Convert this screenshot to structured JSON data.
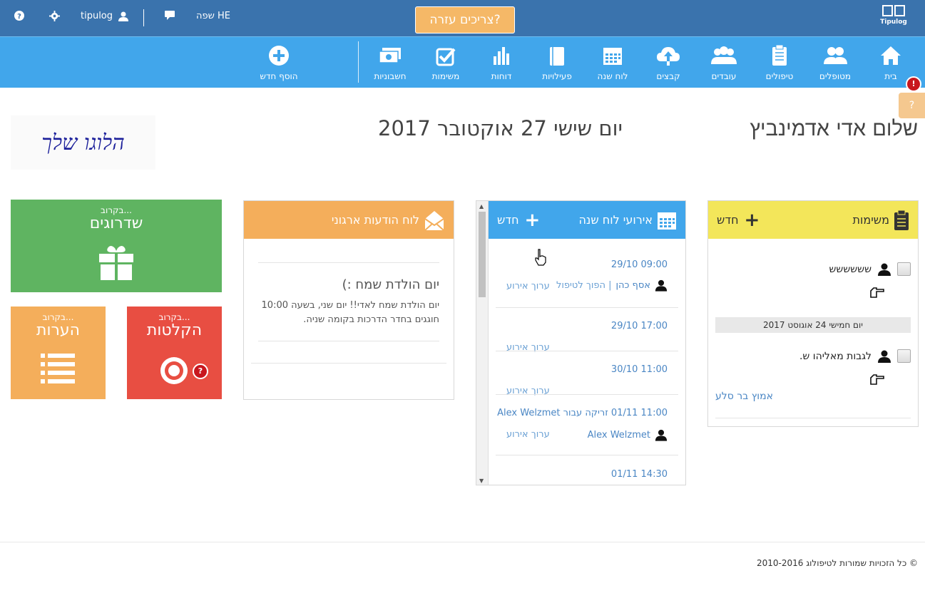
{
  "topbar": {
    "help_button": "צריכים עזרה?",
    "language": "שפה HE",
    "username": "tipulog",
    "brand": "Tipulog"
  },
  "nav": [
    {
      "label": "בית",
      "icon": "home-icon"
    },
    {
      "label": "מטופלים",
      "icon": "patients-icon"
    },
    {
      "label": "טיפולים",
      "icon": "clipboard-icon"
    },
    {
      "label": "עובדים",
      "icon": "workers-icon"
    },
    {
      "label": "קבצים",
      "icon": "cloud-upload-icon"
    },
    {
      "label": "לוח שנה",
      "icon": "calendar-icon"
    },
    {
      "label": "פעילויות",
      "icon": "book-icon"
    },
    {
      "label": "דוחות",
      "icon": "bar-chart-icon"
    },
    {
      "label": "משימות",
      "icon": "check-icon"
    },
    {
      "label": "חשבוניות",
      "icon": "money-icon"
    },
    {
      "label": "הוסף חדש",
      "icon": "plus-circle-icon"
    }
  ],
  "notification_badge": "!",
  "header": {
    "greeting": "שלום אדי אדמינביץ",
    "date": "יום שישי 27 אוקטובר 2017",
    "logo_placeholder": "הלוגו שלך"
  },
  "tasks": {
    "title": "משימות",
    "new_label": "חדש",
    "items": [
      {
        "text": "שששששש"
      },
      {
        "text": "לגבות מאליהו ש."
      }
    ],
    "date_group": "יום חמישי 24 אוגוסט 2017",
    "assignee": "אמוץ בר סלע"
  },
  "events": {
    "title": "אירועי לוח שנה",
    "new_label": "חדש",
    "edit_label": "ערוך אירוע",
    "items": [
      {
        "when": "09:00 29/10",
        "person": "אסף כהן",
        "extra": "| הפוך לטיפול"
      },
      {
        "when": "17:00 29/10"
      },
      {
        "when": "11:00 30/10"
      },
      {
        "when": "11:00 01/11 זריקה עבור Alex Welzmet",
        "person": "Alex Welzmet"
      },
      {
        "when": "14:30 01/11"
      }
    ]
  },
  "bulletin": {
    "title": "לוח הודעות ארגוני",
    "post_title": "יום הולדת שמח :)",
    "post_text": "יום הולדת שמח לאדי!! יום שני, בשעה 10:00 חוגגים בחדר הדרכות בקומה שניה."
  },
  "tiles": {
    "soon": "בקרוב...",
    "upgrades": "שדרוגים",
    "notes": "הערות",
    "records": "הקלטות",
    "records_badge": "?"
  },
  "footer": "© כל הזכויות שמורות לטיפולוג 2010-2016"
}
